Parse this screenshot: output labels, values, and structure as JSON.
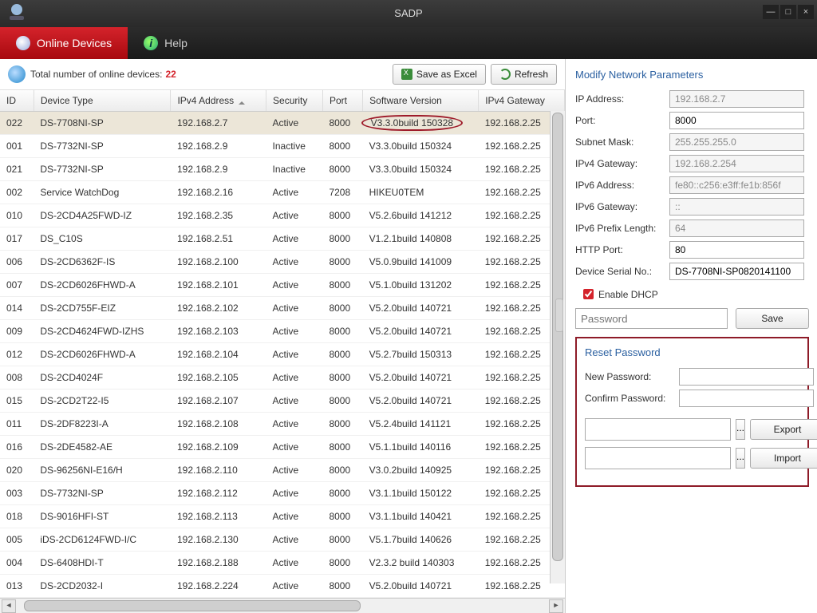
{
  "window": {
    "title": "SADP"
  },
  "tabs": {
    "online": "Online Devices",
    "help": "Help"
  },
  "toolbar": {
    "count_label": "Total number of online devices:",
    "count": "22",
    "save_excel": "Save as Excel",
    "refresh": "Refresh"
  },
  "columns": [
    "ID",
    "Device Type",
    "IPv4 Address",
    "Security",
    "Port",
    "Software Version",
    "IPv4 Gateway"
  ],
  "rows": [
    {
      "id": "022",
      "type": "DS-7708NI-SP",
      "ip": "192.168.2.7",
      "sec": "Active",
      "port": "8000",
      "ver": "V3.3.0build 150328",
      "gw": "192.168.2.25",
      "selected": true,
      "circled": true
    },
    {
      "id": "001",
      "type": "DS-7732NI-SP",
      "ip": "192.168.2.9",
      "sec": "Inactive",
      "port": "8000",
      "ver": "V3.3.0build 150324",
      "gw": "192.168.2.25"
    },
    {
      "id": "021",
      "type": "DS-7732NI-SP",
      "ip": "192.168.2.9",
      "sec": "Inactive",
      "port": "8000",
      "ver": "V3.3.0build 150324",
      "gw": "192.168.2.25"
    },
    {
      "id": "002",
      "type": "Service WatchDog",
      "ip": "192.168.2.16",
      "sec": "Active",
      "port": "7208",
      "ver": "HIKEU0TEM",
      "gw": "192.168.2.25"
    },
    {
      "id": "010",
      "type": "DS-2CD4A25FWD-IZ",
      "ip": "192.168.2.35",
      "sec": "Active",
      "port": "8000",
      "ver": "V5.2.6build 141212",
      "gw": "192.168.2.25"
    },
    {
      "id": "017",
      "type": "DS_C10S",
      "ip": "192.168.2.51",
      "sec": "Active",
      "port": "8000",
      "ver": "V1.2.1build 140808",
      "gw": "192.168.2.25"
    },
    {
      "id": "006",
      "type": "DS-2CD6362F-IS",
      "ip": "192.168.2.100",
      "sec": "Active",
      "port": "8000",
      "ver": "V5.0.9build 141009",
      "gw": "192.168.2.25"
    },
    {
      "id": "007",
      "type": "DS-2CD6026FHWD-A",
      "ip": "192.168.2.101",
      "sec": "Active",
      "port": "8000",
      "ver": "V5.1.0build 131202",
      "gw": "192.168.2.25"
    },
    {
      "id": "014",
      "type": "DS-2CD755F-EIZ",
      "ip": "192.168.2.102",
      "sec": "Active",
      "port": "8000",
      "ver": "V5.2.0build 140721",
      "gw": "192.168.2.25"
    },
    {
      "id": "009",
      "type": "DS-2CD4624FWD-IZHS",
      "ip": "192.168.2.103",
      "sec": "Active",
      "port": "8000",
      "ver": "V5.2.0build 140721",
      "gw": "192.168.2.25"
    },
    {
      "id": "012",
      "type": "DS-2CD6026FHWD-A",
      "ip": "192.168.2.104",
      "sec": "Active",
      "port": "8000",
      "ver": "V5.2.7build 150313",
      "gw": "192.168.2.25"
    },
    {
      "id": "008",
      "type": "DS-2CD4024F",
      "ip": "192.168.2.105",
      "sec": "Active",
      "port": "8000",
      "ver": "V5.2.0build 140721",
      "gw": "192.168.2.25"
    },
    {
      "id": "015",
      "type": "DS-2CD2T22-I5",
      "ip": "192.168.2.107",
      "sec": "Active",
      "port": "8000",
      "ver": "V5.2.0build 140721",
      "gw": "192.168.2.25"
    },
    {
      "id": "011",
      "type": "DS-2DF8223I-A",
      "ip": "192.168.2.108",
      "sec": "Active",
      "port": "8000",
      "ver": "V5.2.4build 141121",
      "gw": "192.168.2.25"
    },
    {
      "id": "016",
      "type": "DS-2DE4582-AE",
      "ip": "192.168.2.109",
      "sec": "Active",
      "port": "8000",
      "ver": "V5.1.1build 140116",
      "gw": "192.168.2.25"
    },
    {
      "id": "020",
      "type": "DS-96256NI-E16/H",
      "ip": "192.168.2.110",
      "sec": "Active",
      "port": "8000",
      "ver": "V3.0.2build 140925",
      "gw": "192.168.2.25"
    },
    {
      "id": "003",
      "type": "DS-7732NI-SP",
      "ip": "192.168.2.112",
      "sec": "Active",
      "port": "8000",
      "ver": "V3.1.1build 150122",
      "gw": "192.168.2.25"
    },
    {
      "id": "018",
      "type": "DS-9016HFI-ST",
      "ip": "192.168.2.113",
      "sec": "Active",
      "port": "8000",
      "ver": "V3.1.1build 140421",
      "gw": "192.168.2.25"
    },
    {
      "id": "005",
      "type": "iDS-2CD6124FWD-I/C",
      "ip": "192.168.2.130",
      "sec": "Active",
      "port": "8000",
      "ver": "V5.1.7build 140626",
      "gw": "192.168.2.25"
    },
    {
      "id": "004",
      "type": "DS-6408HDI-T",
      "ip": "192.168.2.188",
      "sec": "Active",
      "port": "8000",
      "ver": "V2.3.2 build 140303",
      "gw": "192.168.2.25"
    },
    {
      "id": "013",
      "type": "DS-2CD2032-I",
      "ip": "192.168.2.224",
      "sec": "Active",
      "port": "8000",
      "ver": "V5.2.0build 140721",
      "gw": "192.168.2.25"
    }
  ],
  "right": {
    "title": "Modify Network Parameters",
    "ip_label": "IP Address:",
    "ip": "192.168.2.7",
    "port_label": "Port:",
    "port": "8000",
    "mask_label": "Subnet Mask:",
    "mask": "255.255.255.0",
    "gw_label": "IPv4 Gateway:",
    "gw": "192.168.2.254",
    "ipv6a_label": "IPv6 Address:",
    "ipv6a": "fe80::c256:e3ff:fe1b:856f",
    "ipv6g_label": "IPv6 Gateway:",
    "ipv6g": "::",
    "ipv6p_label": "IPv6 Prefix Length:",
    "ipv6p": "64",
    "http_label": "HTTP Port:",
    "http": "80",
    "serial_label": "Device Serial No.:",
    "serial": "DS-7708NI-SP0820141100",
    "dhcp_label": "Enable DHCP",
    "pw_placeholder": "Password",
    "save": "Save",
    "reset_title": "Reset Password",
    "newpw_label": "New Password:",
    "confirmpw_label": "Confirm Password:",
    "export": "Export",
    "import": "Import",
    "dots": "..."
  }
}
